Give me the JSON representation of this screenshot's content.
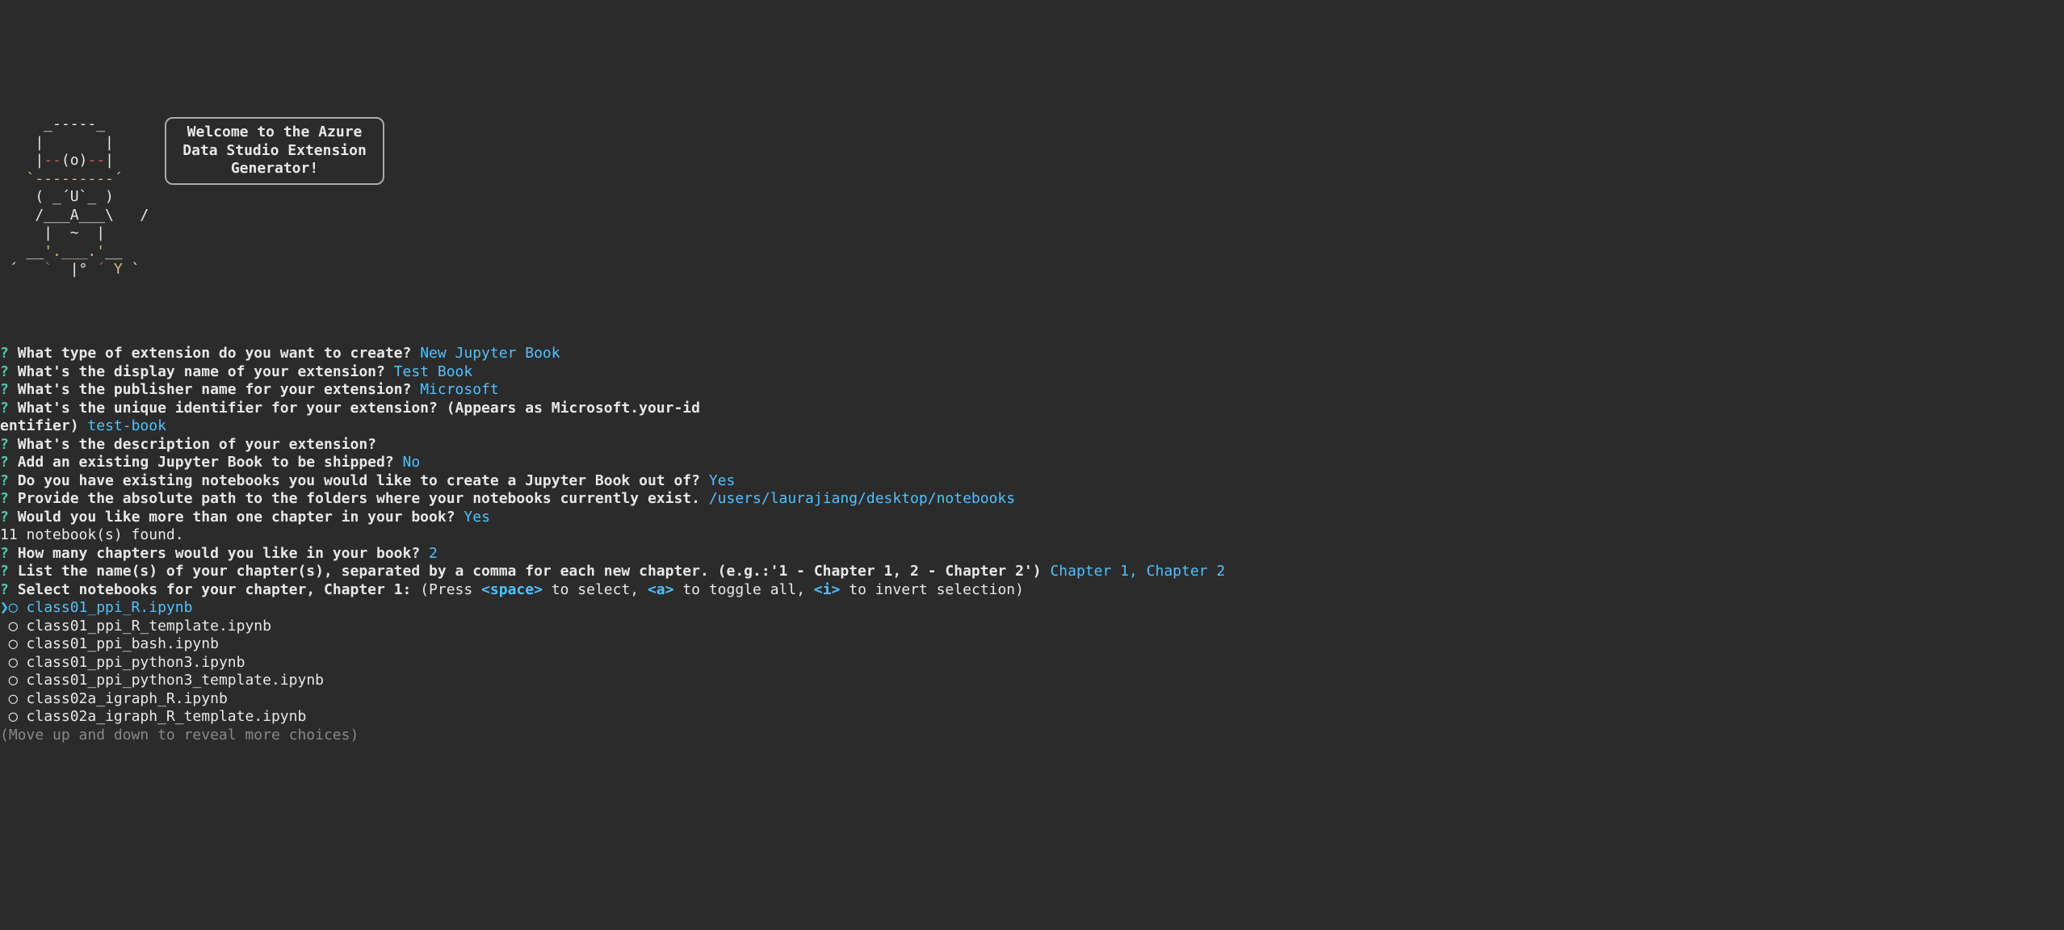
{
  "ascii_art": "     _-----_\n    |       |\n    |--(o)--|\n   `---------´\n    ( _´U`_ )\n    /___A___\\   /\n     |  ~  |\n   __'.___.'__\n ´   `  |° ´ Y `",
  "welcome": "Welcome to the Azure\nData Studio Extension\nGenerator!",
  "prompts": [
    {
      "q": "What type of extension do you want to create?",
      "a": "New Jupyter Book"
    },
    {
      "q": "What's the display name of your extension?",
      "a": "Test Book"
    },
    {
      "q": "What's the publisher name for your extension?",
      "a": "Microsoft"
    },
    {
      "q": "What's the unique identifier for your extension? (Appears as Microsoft.your-id",
      "wrap": "entifier)",
      "a": "test-book"
    },
    {
      "q": "What's the description of your extension?",
      "a": ""
    },
    {
      "q": "Add an existing Jupyter Book to be shipped?",
      "a": "No"
    },
    {
      "q": "Do you have existing notebooks you would like to create a Jupyter Book out of?",
      "a": "Yes"
    },
    {
      "q": "Provide the absolute path to the folders where your notebooks currently exist.",
      "a": "/users/laurajiang/desktop/notebooks"
    },
    {
      "q": "Would you like more than one chapter in your book?",
      "a": "Yes"
    }
  ],
  "status": "11 notebook(s) found.",
  "prompts2": [
    {
      "q": "How many chapters would you like in your book?",
      "a": "2"
    },
    {
      "q": "List the name(s) of your chapter(s), separated by a comma for each new chapter. (e.g.:'1 - Chapter 1, 2 - Chapter 2')",
      "a": "Chapter 1, Chapter 2"
    }
  ],
  "select_prompt": {
    "q": "Select notebooks for your chapter, Chapter 1:",
    "hint_pre": " (Press ",
    "key1": "<space>",
    "hint_mid1": " to select, ",
    "key2": "<a>",
    "hint_mid2": " to toggle all, ",
    "key3": "<i>",
    "hint_post": " to invert selection)"
  },
  "notebooks": [
    {
      "name": "class01_ppi_R.ipynb",
      "current": true
    },
    {
      "name": "class01_ppi_R_template.ipynb",
      "current": false
    },
    {
      "name": "class01_ppi_bash.ipynb",
      "current": false
    },
    {
      "name": "class01_ppi_python3.ipynb",
      "current": false
    },
    {
      "name": "class01_ppi_python3_template.ipynb",
      "current": false
    },
    {
      "name": "class02a_igraph_R.ipynb",
      "current": false
    },
    {
      "name": "class02a_igraph_R_template.ipynb",
      "current": false
    }
  ],
  "footer": "(Move up and down to reveal more choices)"
}
